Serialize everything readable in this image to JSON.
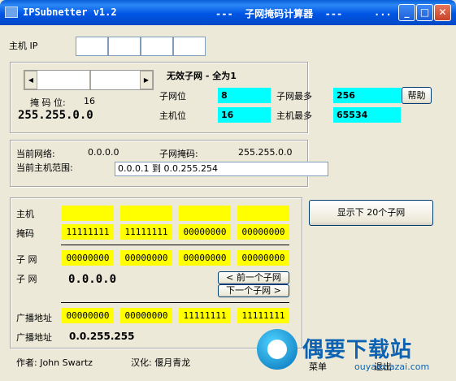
{
  "window": {
    "title_left": "IPSubnetter v1.2",
    "title_center": "---  子网掩码计算器  ---",
    "title_dots": "...",
    "minimize_glyph": "_",
    "maximize_glyph": "□",
    "close_glyph": "✕"
  },
  "host_ip": {
    "label": "主机 IP",
    "octets": [
      "",
      "",
      "",
      ""
    ]
  },
  "mask": {
    "scroll_left": "◀",
    "scroll_right": "▶",
    "bits_label": "掩 码 位:",
    "bits_value": "16",
    "mask_value": "255.255.0.0",
    "heading": "无效子网 - 全为1",
    "subnet_bits_label": "子网位",
    "subnet_bits_value": "8",
    "host_bits_label": "主机位",
    "host_bits_value": "16",
    "max_subnets_label": "子网最多",
    "max_subnets_value": "256",
    "max_hosts_label": "主机最多",
    "max_hosts_value": "65534",
    "help_button": "帮助"
  },
  "current": {
    "network_label": "当前网络:",
    "network_value": "0.0.0.0",
    "mask_label": "子网掩码:",
    "mask_value": "255.255.0.0",
    "range_label": "当前主机范围:",
    "range_value": "0.0.0.1 到 0.0.255.254"
  },
  "binary": {
    "host_label": "主机",
    "host_cells": [
      "",
      "",
      "",
      ""
    ],
    "mask_label": "掩码",
    "mask_cells": [
      "11111111",
      "11111111",
      "00000000",
      "00000000"
    ],
    "subnet_label": "子 网",
    "subnet_cells": [
      "00000000",
      "00000000",
      "00000000",
      "00000000"
    ],
    "subnet_label2": "子 网",
    "subnet_ip": "0.0.0.0",
    "prev_button": "< 前一个子网",
    "next_button": "下一个子网 >",
    "broadcast_label": "广播地址",
    "broadcast_cells": [
      "00000000",
      "00000000",
      "11111111",
      "11111111"
    ],
    "broadcast_label2": "广播地址",
    "broadcast_ip": "0.0.255.255"
  },
  "show_next_button": "显示下 20个子网",
  "footer": {
    "author": "作者: John Swartz",
    "translator": "汉化: 偃月青龙",
    "menu": "菜单",
    "exit": "退出"
  },
  "watermark": {
    "text": "偶要下载站",
    "url": "ouyaoxiazai.com"
  }
}
